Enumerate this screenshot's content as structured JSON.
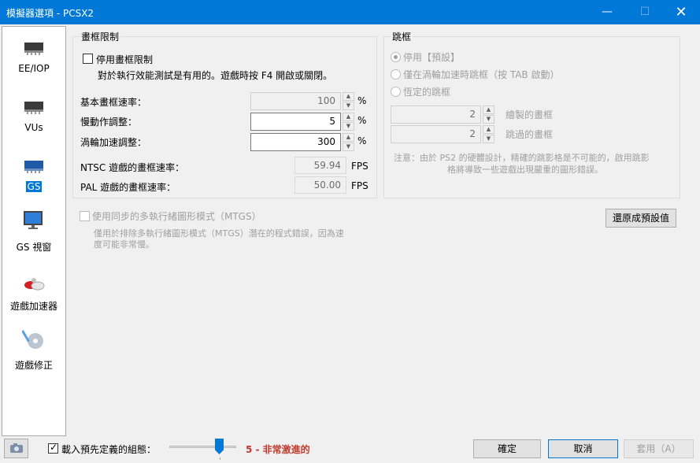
{
  "window": {
    "title": "模擬器選項 - PCSX2",
    "minimize": "—",
    "maximize": "☐",
    "close": "✕"
  },
  "sidebar": {
    "items": [
      {
        "label": "EE/IOP",
        "icon": "cpu-chip-icon",
        "active": false
      },
      {
        "label": "VUs",
        "icon": "cpu-chip-icon",
        "active": false
      },
      {
        "label": "GS",
        "icon": "gpu-chip-icon",
        "active": true
      },
      {
        "label": "GS 視窗",
        "icon": "monitor-icon",
        "active": false
      },
      {
        "label": "遊戲加速器",
        "icon": "speed-hacks-icon",
        "active": false
      },
      {
        "label": "遊戲修正",
        "icon": "game-fixes-icon",
        "active": false
      }
    ]
  },
  "framelimit": {
    "legend": "畫框限制",
    "disable_label": "停用畫框限制",
    "disable_checked": false,
    "note": "對於執行效能測試是有用的。遊戲時按 F4 開啟或關閉。",
    "rows": [
      {
        "label": "基本畫框速率：",
        "value": "100",
        "unit": "%",
        "enabled": false
      },
      {
        "label": "慢動作調整：",
        "value": "5",
        "unit": "%",
        "enabled": true
      },
      {
        "label": "渦輪加速調整：",
        "value": "300",
        "unit": "%",
        "enabled": true
      }
    ],
    "ntsc_label": "NTSC 遊戲的畫框速率：",
    "ntsc_value": "59.94",
    "pal_label": "PAL 遊戲的畫框速率：",
    "pal_value": "50.00",
    "fps_unit": "FPS"
  },
  "frameskip": {
    "legend": "跳框",
    "options": [
      {
        "label": "停用【預設】",
        "selected": true
      },
      {
        "label": "僅在渦輪加速時跳框（按 TAB 啟動）",
        "selected": false
      },
      {
        "label": "恆定的跳框",
        "selected": false
      }
    ],
    "draw_value": "2",
    "draw_label": "繪製的畫框",
    "skip_value": "2",
    "skip_label": "跳過的畫框",
    "note_line1": "注意：由於 PS2 的硬體設計，精確的跳影格是不可能的，啟用跳影",
    "note_line2": "格將導致一些遊戲出現嚴重的圖形錯誤。"
  },
  "mtgs": {
    "label": "使用同步的多執行緒圖形模式（MTGS）",
    "checked": false,
    "note_line1": "僅用於排除多執行緒圖形模式（MTGS）潛在的程式錯誤，因為速",
    "note_line2": "度可能非常慢。"
  },
  "restore_defaults": "還原成預設值",
  "footer": {
    "preset_label": "載入預先定義的組態：",
    "preset_checked": true,
    "preset_value": "5 - 非常激進的",
    "preset_level": 5,
    "preset_max": 6,
    "preset_color": "#c0392b",
    "ok": "確定",
    "cancel": "取消",
    "apply": "套用（A）"
  }
}
